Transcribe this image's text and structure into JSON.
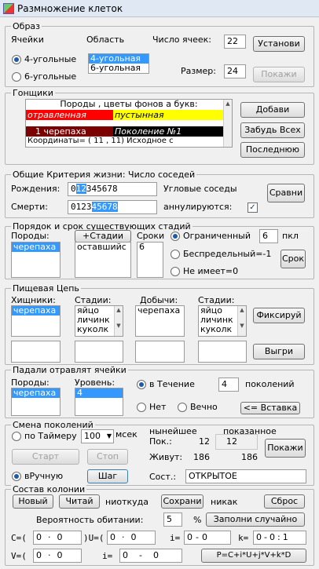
{
  "window": {
    "title": "Размножение клеток"
  },
  "obraz": {
    "title": "Образ",
    "cells_label": "Ячейки",
    "area_label": "Область",
    "count_label": "Число ячеек:",
    "count_value": "22",
    "set_button": "Установи",
    "radio4": "4-угольные",
    "radio6": "6-угольные",
    "area_options": [
      "4-угольная",
      "6-угольная"
    ],
    "size_label": "Размер:",
    "size_value": "24",
    "show_button": "Покажи"
  },
  "gonshiki": {
    "title": "Гонщики",
    "header": "Породы , цветы фонов а букв:",
    "row1_a": "отравленная",
    "row1_b": "пустынная",
    "row2_a": "1 черепаха",
    "row2_b": "Поколение №1",
    "row3": "Координаты= ( 11 , 11) Исходное с",
    "add_button": "Добави",
    "forget_button": "Забудь Всех",
    "last_button": "Последнюю"
  },
  "criteria": {
    "title": "Общие Критерия жизни: Число соседей",
    "birth_label": "Рождения:",
    "birth_pre": "0",
    "birth_sel": "12",
    "birth_post": "345678",
    "corner_label": "Угловые соседы",
    "death_label": "Смерти:",
    "death_pre": "0123",
    "death_sel": "45678",
    "cancel_label": "аннулируются:",
    "compare_button": "Сравни"
  },
  "order": {
    "title": "Порядок и срок существующих стадий",
    "breeds_label": "Породы:",
    "stages_button": "+Стадии",
    "terms_label": "Сроки",
    "breed_item": "черепаха",
    "stage_item": "оставшийс",
    "term_item": "6",
    "limited_label": "Ограниченный",
    "limited_value": "6",
    "pkl": "пкл",
    "unlimited_label": "Беспредельный=-1",
    "none_label": "Не имеет=0",
    "term_button": "Срок"
  },
  "food": {
    "title": "Пищевая Цепь",
    "predators_label": "Хищники:",
    "stages_label": "Стадии:",
    "prey_label": "Добычи:",
    "stages2_label": "Стадии:",
    "predator_item": "черепаха",
    "stage_items": [
      "яйцо",
      "личинк",
      "куколк"
    ],
    "prey_item": "черепаха",
    "stage2_items": [
      "яйцо",
      "личинк",
      "куколк"
    ],
    "fix_button": "Фиксируй",
    "out_button": "Выгри"
  },
  "fallen": {
    "title": "Падали отравлят ячейки",
    "breeds_label": "Породы:",
    "level_label": "Уровень:",
    "breed_item": "черепаха",
    "level_item": "4",
    "during_label": "в Течение",
    "during_value": "4",
    "generations_label": "поколений",
    "no_label": "Нет",
    "forever_label": "Вечно",
    "insert_button": "<= Вставка"
  },
  "change": {
    "title": "Смена поколений",
    "timer_label": "по Таймеру",
    "timer_value": "100",
    "msec": "мсек",
    "current_label": "нынейшее",
    "shown_label": "показанное",
    "pok_label": "Пок.:",
    "pok_current": "12",
    "pok_shown": "12",
    "alive_label": "Живут:",
    "alive_current": "186",
    "alive_shown": "186",
    "show_button": "Покажи",
    "start_button": "Старт",
    "stop_button": "Стоп",
    "manual_label": "вРучную",
    "step_button": "Шаг",
    "state_label": "Сост.:",
    "state_value": "ОТКРЫТОЕ"
  },
  "colony": {
    "title": "Состав колонии",
    "new_button": "Новый",
    "read_button": "Читай",
    "from_text": "ниоткуда",
    "save_button": "Сохрани",
    "nowhere_text": "никак",
    "reset_button": "Сброс",
    "prob_label": "Вероятность обитании:",
    "prob_value": "5",
    "pct": "%",
    "fill_button": "Заполни случайно",
    "c_label": "C=(",
    "c1": "0",
    "c2": "0",
    "u_label": ")U=(",
    "u1": "0",
    "u2": "0",
    "i_label": "i=",
    "i1": "0",
    "i2": "0",
    "k_label": "k=",
    "k1": "0",
    "k2": "0",
    "k3": "1",
    "v_label": "V=(",
    "v1": "0",
    "v2": "0",
    "i2_label": "i=",
    "i3": "0",
    "i4": "0",
    "formula_button": "P=C+i*U+j*V+k*D"
  },
  "colors": {
    "poison": "#ff0000",
    "desert": "#ffff00",
    "turtle": "#7b0000",
    "generation": "#000000",
    "select": "#3399ff"
  }
}
